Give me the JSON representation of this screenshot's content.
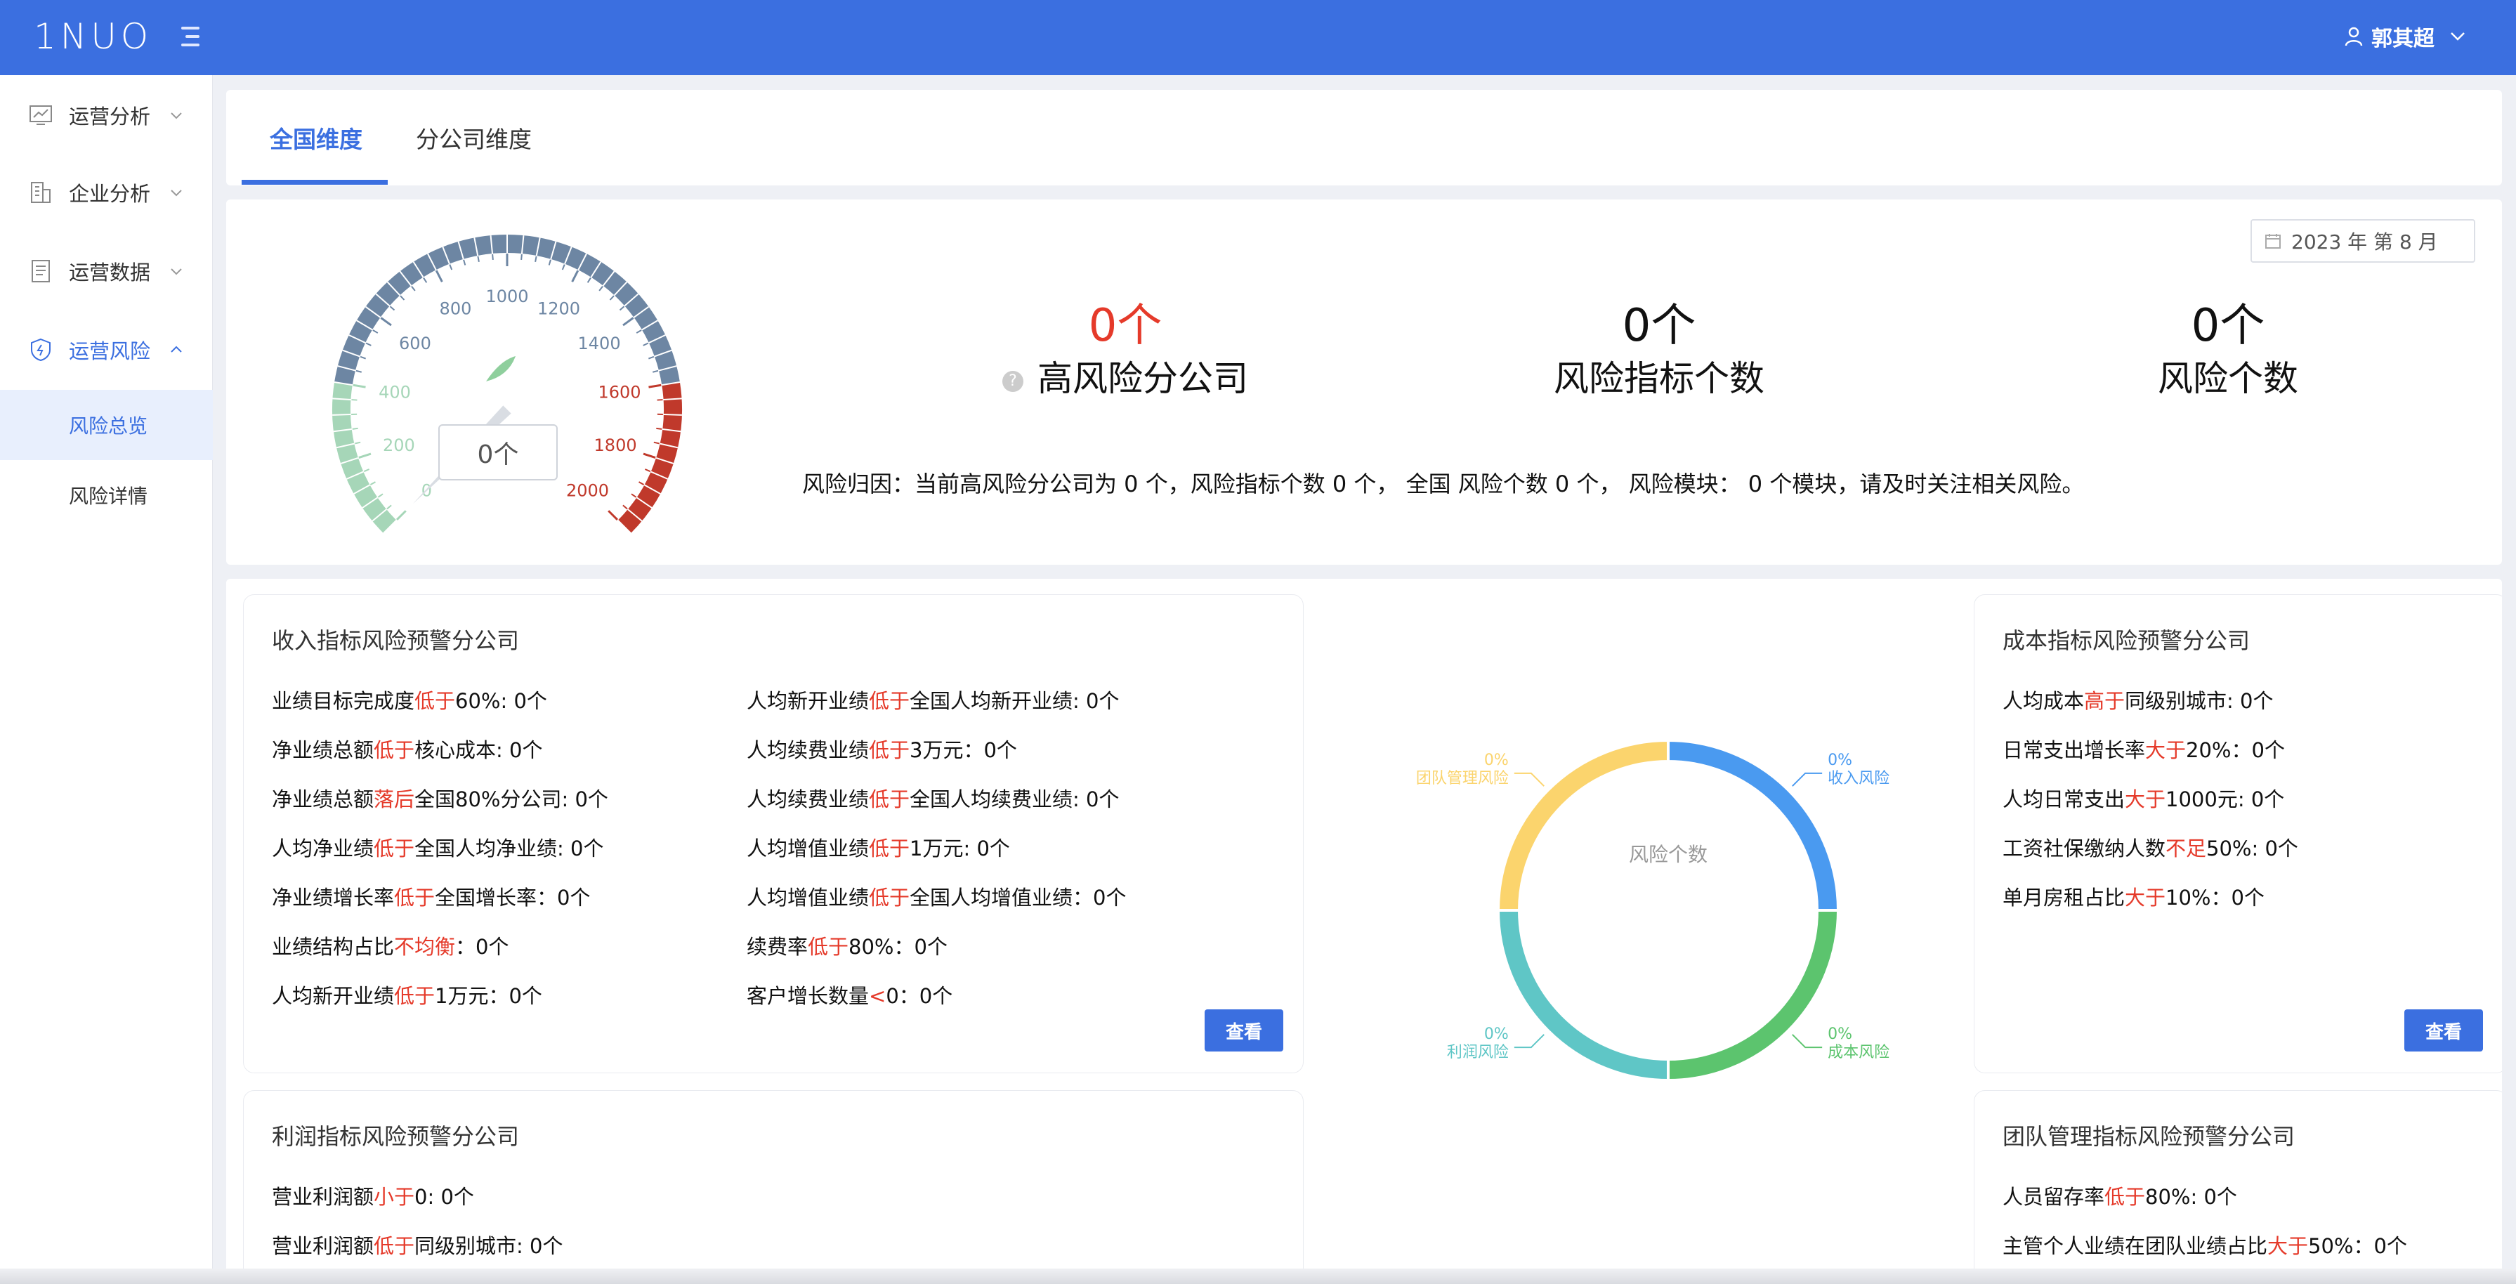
{
  "app": {
    "logo_text": "1NUO",
    "user_name": "郭其超"
  },
  "sidebar": {
    "items": [
      {
        "label": "运营分析",
        "icon": "chart-icon"
      },
      {
        "label": "企业分析",
        "icon": "building-icon"
      },
      {
        "label": "运营数据",
        "icon": "document-icon"
      },
      {
        "label": "运营风险",
        "icon": "shield-icon",
        "expanded": true
      }
    ],
    "sub_items": [
      {
        "label": "风险总览",
        "selected": true
      },
      {
        "label": "风险详情",
        "selected": false
      }
    ]
  },
  "tabs": [
    {
      "label": "全国维度",
      "active": true
    },
    {
      "label": "分公司维度",
      "active": false
    }
  ],
  "summary": {
    "date": "2023 年 第 8 月",
    "gauge": {
      "value_label": "0个",
      "value": 0,
      "min": 0,
      "max": 2000,
      "ticks": [
        "0",
        "200",
        "400",
        "600",
        "800",
        "1000",
        "1200",
        "1400",
        "1600",
        "1800",
        "2000"
      ]
    },
    "stats": [
      {
        "value": "0个",
        "label": "高风险分公司"
      },
      {
        "value": "0个",
        "label": "风险指标个数"
      },
      {
        "value": "0个",
        "label": "风险个数"
      }
    ],
    "cause_text": "风险归因：当前高风险分公司为 0 个，风险指标个数 0 个， 全国 风险个数 0 个， 风险模块： 0 个模块，请及时关注相关风险。"
  },
  "income_panel": {
    "title": "收入指标风险预警分公司",
    "button": "查看",
    "rules_left": [
      {
        "pre": "业绩目标完成度",
        "hl": "低于",
        "post": "60%: 0个"
      },
      {
        "pre": "净业绩总额",
        "hl": "低于",
        "post": "核心成本: 0个"
      },
      {
        "pre": "净业绩总额",
        "hl": "落后",
        "post": "全国80%分公司: 0个"
      },
      {
        "pre": "人均净业绩",
        "hl": "低于",
        "post": "全国人均净业绩: 0个"
      },
      {
        "pre": "净业绩增长率",
        "hl": "低于",
        "post": "全国增长率：0个"
      },
      {
        "pre": "业绩结构占比",
        "hl": "不均衡",
        "post": "：0个"
      },
      {
        "pre": "人均新开业绩",
        "hl": "低于",
        "post": "1万元：0个"
      }
    ],
    "rules_right": [
      {
        "pre": "人均新开业绩",
        "hl": "低于",
        "post": "全国人均新开业绩: 0个"
      },
      {
        "pre": "人均续费业绩",
        "hl": "低于",
        "post": "3万元：0个"
      },
      {
        "pre": "人均续费业绩",
        "hl": "低于",
        "post": "全国人均续费业绩: 0个"
      },
      {
        "pre": "人均增值业绩",
        "hl": "低于",
        "post": "1万元: 0个"
      },
      {
        "pre": "人均增值业绩",
        "hl": "低于",
        "post": "全国人均增值业绩：0个"
      },
      {
        "pre": "续费率",
        "hl": "低于",
        "post": "80%：0个"
      },
      {
        "pre": "客户增长数量",
        "hl": "<",
        "post": "0：0个"
      }
    ]
  },
  "profit_panel": {
    "title": "利润指标风险预警分公司",
    "rules": [
      {
        "pre": "营业利润额",
        "hl": "小于",
        "post": "0: 0个"
      },
      {
        "pre": "营业利润额",
        "hl": "低于",
        "post": "同级别城市: 0个"
      }
    ]
  },
  "cost_panel": {
    "title": "成本指标风险预警分公司",
    "button": "查看",
    "rules": [
      {
        "pre": "人均成本",
        "hl": "高于",
        "post": "同级别城市: 0个"
      },
      {
        "pre": "日常支出增长率",
        "hl": "大于",
        "post": "20%：0个"
      },
      {
        "pre": "人均日常支出",
        "hl": "大于",
        "post": "1000元: 0个"
      },
      {
        "pre": "工资社保缴纳人数",
        "hl": "不足",
        "post": "50%: 0个"
      },
      {
        "pre": "单月房租占比",
        "hl": "大于",
        "post": "10%：0个"
      }
    ]
  },
  "team_panel": {
    "title": "团队管理指标风险预警分公司",
    "rules": [
      {
        "pre": "人员留存率",
        "hl": "低于",
        "post": "80%: 0个"
      },
      {
        "pre": "主管个人业绩在团队业绩占比",
        "hl": "大于",
        "post": "50%：0个"
      }
    ]
  },
  "chart_data": {
    "type": "pie",
    "title": "风险个数",
    "series": [
      {
        "name": "收入风险",
        "value": 0,
        "percent_label": "0%",
        "color": "#4a9af0"
      },
      {
        "name": "成本风险",
        "value": 0,
        "percent_label": "0%",
        "color": "#5cc46e"
      },
      {
        "name": "利润风险",
        "value": 0,
        "percent_label": "0%",
        "color": "#5fc6c6"
      },
      {
        "name": "团队管理风险",
        "value": 0,
        "percent_label": "0%",
        "color": "#fbd46d"
      }
    ],
    "legend_position": "top-right"
  },
  "colors": {
    "primary": "#3b6fe0",
    "danger": "#e53a2a"
  }
}
